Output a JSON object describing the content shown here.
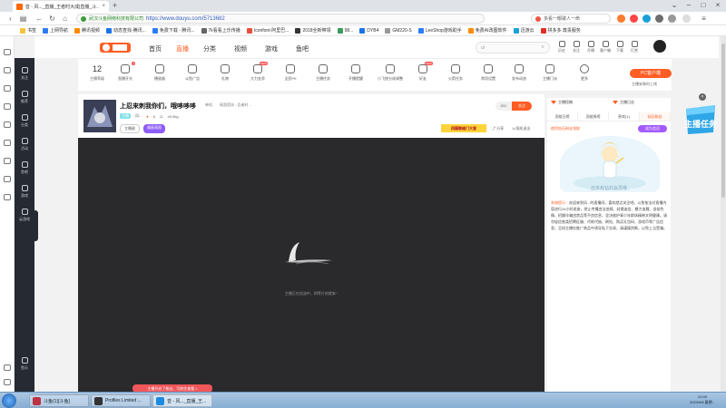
{
  "browser": {
    "tab_active_title": "音 - 风..._直播_王者时大成|直播_斗...",
    "url_site": "武汉斗鱼网络科技有限公司",
    "url": "https://www.douyu.com/5713682",
    "search_placeholder": "多看一眼歌人一命",
    "bookmarks": [
      "书签",
      "上网导航",
      "腾讯视频",
      "动态查找-腾讯...",
      "免费下载 - 腾讯...",
      "7k看看上乐传播",
      "Iconfont-阿里巴...",
      "2018全新带领",
      "98...",
      "DYB4",
      "GM220-S",
      "LeeShop游戏助手",
      "免费AI改图软件",
      "迅游云",
      "拼多多 尊贵服务"
    ]
  },
  "douyu_nav": {
    "items": [
      "首页",
      "直播",
      "分类",
      "视频",
      "游戏",
      "鱼吧"
    ],
    "active": "直播",
    "search_value": "ul",
    "tools": [
      "历史",
      "关注",
      "开播",
      "客户端",
      "下载",
      "打赏"
    ]
  },
  "left_nav": [
    "关注",
    "推荐",
    "分类",
    "活动",
    "鱼吧",
    "游戏",
    "云游戏",
    "鱼乐"
  ],
  "feature_bar": {
    "level": "12",
    "level_label": "主播等级",
    "items": [
      {
        "label": "直播开光",
        "badge": "3"
      },
      {
        "label": "播放器",
        "badge": ""
      },
      {
        "label": "斗鱼广告",
        "badge": ""
      },
      {
        "label": "礼物",
        "badge": ""
      },
      {
        "label": "大力金斧",
        "badge": "NEW"
      },
      {
        "label": "全民PK",
        "badge": ""
      },
      {
        "label": "主播任务",
        "badge": ""
      },
      {
        "label": "开播提醒",
        "badge": ""
      },
      {
        "label": "小飞侠分成调整",
        "badge": ""
      },
      {
        "label": "好友",
        "badge": "NEW"
      },
      {
        "label": "火箭任务",
        "badge": ""
      },
      {
        "label": "常用设置",
        "badge": ""
      },
      {
        "label": "发布动态",
        "badge": ""
      },
      {
        "label": "主播门派",
        "badge": ""
      },
      {
        "label": "更多",
        "badge": ""
      }
    ],
    "pc_button": "PC客户端",
    "pc_sub": "主播安装时上线"
  },
  "room": {
    "title": "上忍来刺我你们，哦哆哆哆",
    "category": "单机",
    "tags": "网游竞技 · 忍者村...",
    "anchor": "风...",
    "hot": "6",
    "weight": "49.5kg",
    "chip": "主播",
    "follow_count": "831",
    "follow_label": "关注",
    "promo": "四国联络门大冒",
    "actions": [
      "分享",
      "随机退出"
    ],
    "pills": [
      "主播勋",
      "福星高照"
    ]
  },
  "player": {
    "message": "主播正在加油中，稍等片刻就来~"
  },
  "right_panel": {
    "top_tabs": [
      "主播投稿",
      "主播日志"
    ],
    "tabs": [
      "贡献日榜",
      "贡献周榜",
      "贵宾(1)",
      "钻石粉丝"
    ],
    "active_tab": "钻石粉丝",
    "sub_label": "使用钻石粉丝领取",
    "sub_button": "成为会员",
    "art_text": "还未有钻石会员哦",
    "notice_key": "系统提示：",
    "notice_text": "欢迎来到风...的直播间，喜欢就点关注吧。斗鱼依法对直播内容进行24小时巡查，禁止传播违法违规、封建迷信、暴力血腥、低俗色情、招嫖诈骗违禁品等不良信息，坚决维护青少年群体精神文明健康。请勿轻信各类招聘征婚、代练代抽、刷钻、购买礼包码、游戏币等广告信息，且如主播在推广商品中诱导私下交易，请谨慎判断，以免上当受骗。"
  },
  "floating": {
    "task_badge": "主播任务"
  },
  "bottom_pill": "主播开启了推送，可前往查看",
  "taskbar": {
    "tasks": [
      "斗鱼(1)[斗鱼]",
      "Profiles Limited ...",
      "音 - 风..._直播_王..."
    ],
    "clock_time": "22:00",
    "clock_date": "2023/9/8 星期..."
  },
  "colors": {
    "accent": "#ff5d23",
    "left_nav_bg": "#262a33",
    "player_bg": "#2a2a2c"
  }
}
